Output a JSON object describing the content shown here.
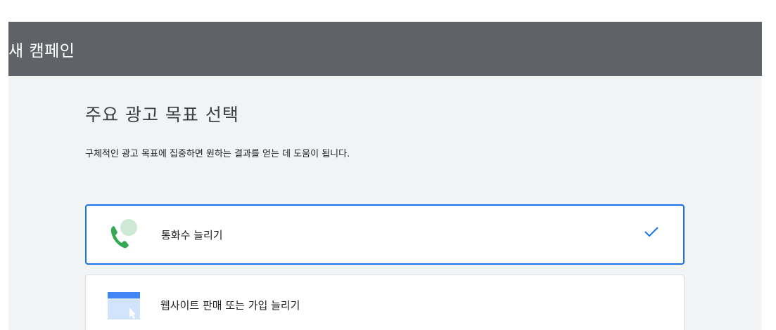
{
  "header": {
    "title": "새 캠페인"
  },
  "main": {
    "title": "주요 광고 목표 선택",
    "description": "구체적인 광고 목표에 집중하면 원하는 결과를 얻는 데 도움이 됩니다.",
    "options": [
      {
        "label": "통화수 늘리기",
        "icon": "phone-call-icon",
        "selected": true
      },
      {
        "label": "웹사이트 판매 또는 가입 늘리기",
        "icon": "website-browser-icon",
        "selected": false
      }
    ]
  },
  "colors": {
    "header_bg": "#5f6368",
    "page_bg": "#f1f3f4",
    "accent": "#1a73e8",
    "phone_green": "#34a853"
  }
}
